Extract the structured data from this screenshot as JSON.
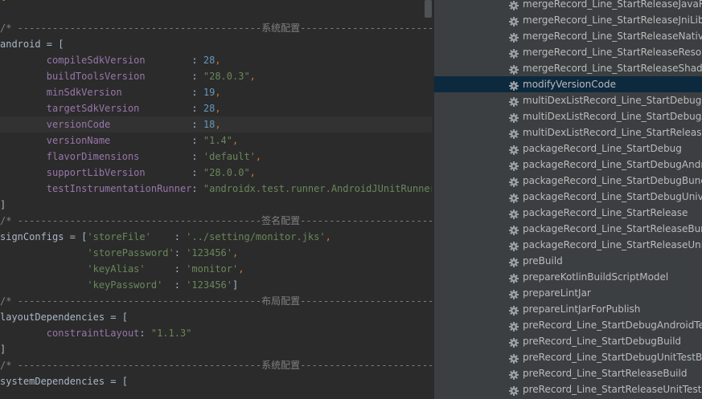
{
  "editor": {
    "lines": [
      [
        {
          "t": "{",
          "c": "punc"
        }
      ],
      [],
      [
        {
          "t": "/* ------------------------------------------系统配置------------------------------------------",
          "c": "cm"
        }
      ],
      [
        {
          "t": "android = [",
          "c": "txt"
        }
      ],
      [
        {
          "t": "        ",
          "c": "txt"
        },
        {
          "t": "compileSdkVersion",
          "c": "key"
        },
        {
          "t": "        : ",
          "c": "txt"
        },
        {
          "t": "28",
          "c": "num"
        },
        {
          "t": ",",
          "c": "punc"
        }
      ],
      [
        {
          "t": "        ",
          "c": "txt"
        },
        {
          "t": "buildToolsVersion",
          "c": "key"
        },
        {
          "t": "        : ",
          "c": "txt"
        },
        {
          "t": "\"28.0.3\"",
          "c": "str"
        },
        {
          "t": ",",
          "c": "punc"
        }
      ],
      [
        {
          "t": "        ",
          "c": "txt"
        },
        {
          "t": "minSdkVersion",
          "c": "key"
        },
        {
          "t": "            : ",
          "c": "txt"
        },
        {
          "t": "19",
          "c": "num"
        },
        {
          "t": ",",
          "c": "punc"
        }
      ],
      [
        {
          "t": "        ",
          "c": "txt"
        },
        {
          "t": "targetSdkVersion",
          "c": "key"
        },
        {
          "t": "         : ",
          "c": "txt"
        },
        {
          "t": "28",
          "c": "num"
        },
        {
          "t": ",",
          "c": "punc"
        }
      ],
      [
        {
          "t": "        ",
          "c": "txt"
        },
        {
          "t": "versionCode",
          "c": "key"
        },
        {
          "t": "              : ",
          "c": "txt"
        },
        {
          "t": "18",
          "c": "num"
        },
        {
          "t": ",",
          "c": "punc"
        }
      ],
      [
        {
          "t": "        ",
          "c": "txt"
        },
        {
          "t": "versionName",
          "c": "key"
        },
        {
          "t": "              : ",
          "c": "txt"
        },
        {
          "t": "\"1.4\"",
          "c": "str"
        },
        {
          "t": ",",
          "c": "punc"
        }
      ],
      [
        {
          "t": "        ",
          "c": "txt"
        },
        {
          "t": "flavorDimensions",
          "c": "key"
        },
        {
          "t": "         : ",
          "c": "txt"
        },
        {
          "t": "'default'",
          "c": "str"
        },
        {
          "t": ",",
          "c": "punc"
        }
      ],
      [
        {
          "t": "        ",
          "c": "txt"
        },
        {
          "t": "supportLibVersion",
          "c": "key"
        },
        {
          "t": "        : ",
          "c": "txt"
        },
        {
          "t": "\"28.0.0\"",
          "c": "str"
        },
        {
          "t": ",",
          "c": "punc"
        }
      ],
      [
        {
          "t": "        ",
          "c": "txt"
        },
        {
          "t": "testInstrumentationRunner",
          "c": "key"
        },
        {
          "t": ": ",
          "c": "txt"
        },
        {
          "t": "\"androidx.test.runner.AndroidJUnitRunner\"",
          "c": "str"
        }
      ],
      [
        {
          "t": "]",
          "c": "txt"
        }
      ],
      [
        {
          "t": "/* ------------------------------------------签名配置------------------------------------------",
          "c": "cm"
        }
      ],
      [
        {
          "t": "signConfigs = [",
          "c": "txt"
        },
        {
          "t": "'storeFile'",
          "c": "str"
        },
        {
          "t": "    : ",
          "c": "txt"
        },
        {
          "t": "'../setting/monitor.jks'",
          "c": "str"
        },
        {
          "t": ",",
          "c": "punc"
        }
      ],
      [
        {
          "t": "               ",
          "c": "txt"
        },
        {
          "t": "'storePassword'",
          "c": "str"
        },
        {
          "t": ": ",
          "c": "txt"
        },
        {
          "t": "'123456'",
          "c": "str"
        },
        {
          "t": ",",
          "c": "punc"
        }
      ],
      [
        {
          "t": "               ",
          "c": "txt"
        },
        {
          "t": "'keyAlias'",
          "c": "str"
        },
        {
          "t": "     : ",
          "c": "txt"
        },
        {
          "t": "'monitor'",
          "c": "str"
        },
        {
          "t": ",",
          "c": "punc"
        }
      ],
      [
        {
          "t": "               ",
          "c": "txt"
        },
        {
          "t": "'keyPassword'",
          "c": "str"
        },
        {
          "t": "  : ",
          "c": "txt"
        },
        {
          "t": "'123456'",
          "c": "str"
        },
        {
          "t": "]",
          "c": "txt"
        }
      ],
      [
        {
          "t": "/* ------------------------------------------布局配置------------------------------------------",
          "c": "cm"
        }
      ],
      [
        {
          "t": "layoutDependencies = [",
          "c": "txt"
        }
      ],
      [
        {
          "t": "        ",
          "c": "txt"
        },
        {
          "t": "constraintLayout",
          "c": "key"
        },
        {
          "t": ": ",
          "c": "txt"
        },
        {
          "t": "\"1.1.3\"",
          "c": "str"
        }
      ],
      [
        {
          "t": "]",
          "c": "txt"
        }
      ],
      [
        {
          "t": "/* ------------------------------------------系统配置------------------------------------------",
          "c": "cm"
        }
      ],
      [
        {
          "t": "systemDependencies = [",
          "c": "txt"
        }
      ]
    ],
    "highlight_line": 8
  },
  "tasks": {
    "items": [
      "mergeRecord_Line_StartReleaseJavaResource",
      "mergeRecord_Line_StartReleaseJniLibFolders",
      "mergeRecord_Line_StartReleaseNativeLibs",
      "mergeRecord_Line_StartReleaseResources",
      "mergeRecord_Line_StartReleaseShaders",
      "modifyVersionCode",
      "multiDexListRecord_Line_StartDebug",
      "multiDexListRecord_Line_StartDebugAndroidTest",
      "multiDexListRecord_Line_StartRelease",
      "packageRecord_Line_StartDebug",
      "packageRecord_Line_StartDebugAndroidTest",
      "packageRecord_Line_StartDebugBundle",
      "packageRecord_Line_StartDebugUniversalApk",
      "packageRecord_Line_StartRelease",
      "packageRecord_Line_StartReleaseBundle",
      "packageRecord_Line_StartReleaseUniversalApk",
      "preBuild",
      "prepareKotlinBuildScriptModel",
      "prepareLintJar",
      "prepareLintJarForPublish",
      "preRecord_Line_StartDebugAndroidTestBuild",
      "preRecord_Line_StartDebugBuild",
      "preRecord_Line_StartDebugUnitTestBuild",
      "preRecord_Line_StartReleaseBuild",
      "preRecord_Line_StartReleaseUnitTestBuild"
    ],
    "selected_index": 5,
    "icon": "gear-icon"
  },
  "colors": {
    "editor_bg": "#2b2b2b",
    "panel_bg": "#3c3f41",
    "selection": "#0d293e",
    "comment": "#808080",
    "property": "#9876aa",
    "string": "#6a8759",
    "number": "#6897bb"
  }
}
